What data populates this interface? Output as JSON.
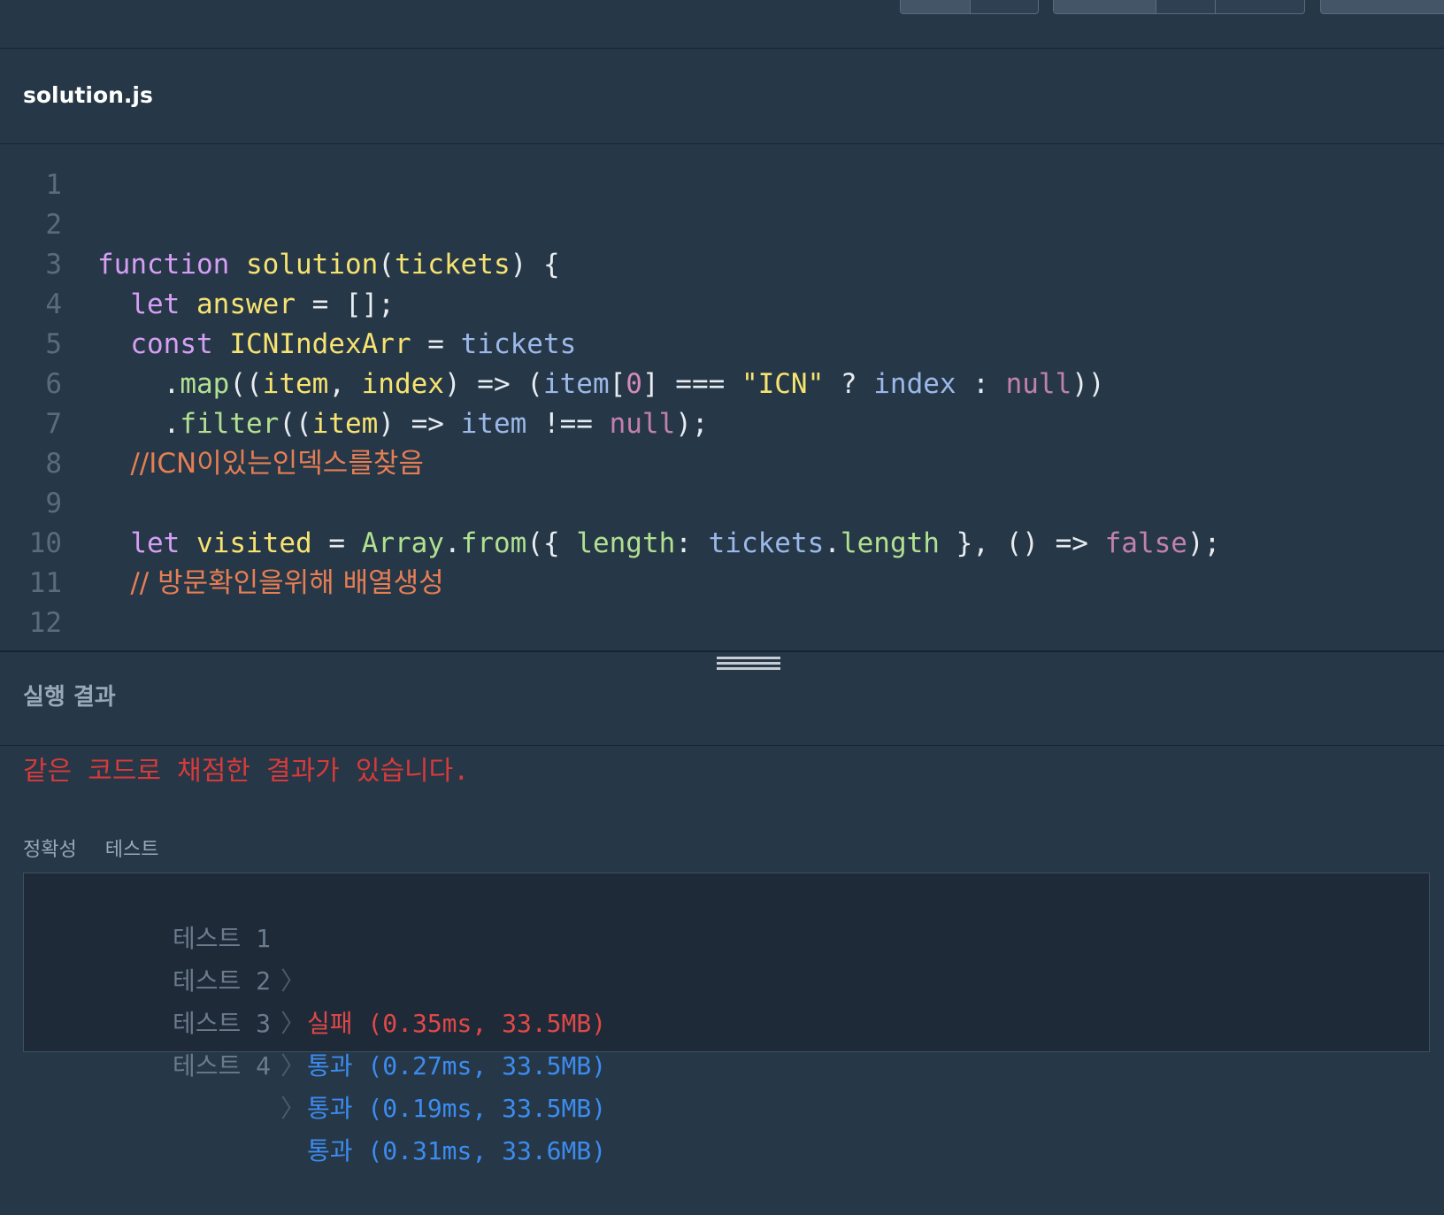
{
  "editor": {
    "filename": "solution.js",
    "lines": [
      {
        "n": "1"
      },
      {
        "n": "2"
      },
      {
        "n": "3"
      },
      {
        "n": "4"
      },
      {
        "n": "5"
      },
      {
        "n": "6"
      },
      {
        "n": "7"
      },
      {
        "n": "8"
      },
      {
        "n": "9"
      },
      {
        "n": "10"
      },
      {
        "n": "11"
      },
      {
        "n": "12"
      }
    ],
    "tokens": {
      "l3": [
        "function",
        " ",
        "solution",
        "(",
        "tickets",
        ") {"
      ],
      "l4": [
        "  ",
        "let",
        " ",
        "answer",
        " = [];"
      ],
      "l5": [
        "  ",
        "const",
        " ",
        "ICNIndexArr",
        " = ",
        "tickets"
      ],
      "l6": [
        "    .",
        "map",
        "((",
        "item",
        ", ",
        "index",
        ") => (",
        "item",
        "[",
        "0",
        "] === ",
        "\"ICN\"",
        " ? ",
        "index",
        " : ",
        "null",
        "))"
      ],
      "l7": [
        "    .",
        "filter",
        "((",
        "item",
        ") => ",
        "item",
        " !== ",
        "null",
        ");"
      ],
      "l8": [
        "  ",
        "//ICN이있는인덱스를찾음"
      ],
      "l10": [
        "  ",
        "let",
        " ",
        "visited",
        " = ",
        "Array",
        ".",
        "from",
        "({ ",
        "length",
        ": ",
        "tickets",
        ".",
        "length",
        " }, () => ",
        "false",
        ");"
      ],
      "l11": [
        "  ",
        "// 방문확인을위해 배열생성"
      ]
    }
  },
  "result": {
    "title": "실행 결과",
    "message": "같은 코드로 채점한 결과가 있습니다.",
    "tabs": [
      "정확성",
      "테스트"
    ],
    "tests": [
      {
        "label": "테스트 1",
        "status": "실패",
        "detail": "(0.35ms, 33.5MB)",
        "ok": false
      },
      {
        "label": "테스트 2",
        "status": "통과",
        "detail": "(0.27ms, 33.5MB)",
        "ok": true
      },
      {
        "label": "테스트 3",
        "status": "통과",
        "detail": "(0.19ms, 33.5MB)",
        "ok": true
      },
      {
        "label": "테스트 4",
        "status": "통과",
        "detail": "(0.31ms, 33.6MB)",
        "ok": true
      }
    ]
  },
  "colors": {
    "background": "#263747",
    "fail": "#e04848",
    "pass": "#3c8cf0",
    "comment": "#e67e54"
  }
}
